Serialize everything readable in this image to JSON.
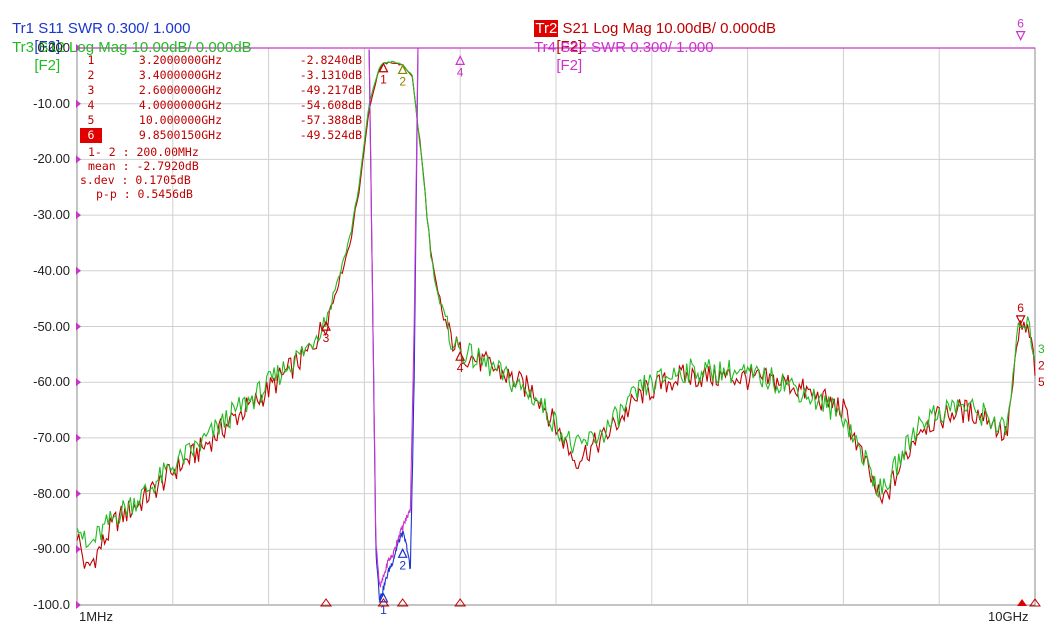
{
  "header": {
    "tr1": {
      "id": "Tr1",
      "text": "Tr1 S11 SWR 0.300/ 1.000",
      "fkey": "[F2]",
      "color": "#1a35d0"
    },
    "tr2": {
      "id": "Tr2",
      "text": " S21 Log Mag 10.00dB/ 0.000dB",
      "fkey": "[F2]",
      "color": "#c00000"
    },
    "tr3": {
      "id": "Tr3",
      "text": "Tr3 S12 Log Mag 10.00dB/ 0.000dB",
      "fkey": "[F2]",
      "color": "#22bb22"
    },
    "tr4": {
      "id": "Tr4",
      "text": "Tr4 S22 SWR 0.300/ 1.000",
      "fkey": "[F2]",
      "color": "#cc33cc"
    }
  },
  "markers": [
    {
      "num": "1",
      "freq": "3.2000000GHz",
      "value": "-2.8240dB",
      "active": false
    },
    {
      "num": "2",
      "freq": "3.4000000GHz",
      "value": "-3.1310dB",
      "active": false
    },
    {
      "num": "3",
      "freq": "2.6000000GHz",
      "value": "-49.217dB",
      "active": false
    },
    {
      "num": "4",
      "freq": "4.0000000GHz",
      "value": "-54.608dB",
      "active": false
    },
    {
      "num": "5",
      "freq": "10.000000GHz",
      "value": "-57.388dB",
      "active": false
    },
    {
      "num": "6",
      "freq": "9.8500150GHz",
      "value": "-49.524dB",
      "active": true
    }
  ],
  "stats": {
    "span": "1- 2 : 200.00MHz",
    "mean": "mean : -2.7920dB",
    "sdev": "s.dev : 0.1705dB",
    "pp": "p-p : 0.5456dB"
  },
  "chart_data": {
    "type": "line",
    "xlabel_start": "1MHz",
    "xlabel_end": "10GHz",
    "xlim_ghz": [
      0.001,
      10
    ],
    "ylim": [
      -100,
      0
    ],
    "yticks": [
      "0.000",
      "-10.00",
      "-20.00",
      "-30.00",
      "-40.00",
      "-50.00",
      "-60.00",
      "-70.00",
      "-80.00",
      "-90.00",
      "-100.0"
    ],
    "grid": true,
    "series": [
      {
        "name": "S21",
        "color": "#c00000",
        "x": [
          0.001,
          0.1,
          0.4,
          0.7,
          1.0,
          1.3,
          1.6,
          1.9,
          2.2,
          2.4,
          2.6,
          2.75,
          2.85,
          2.95,
          3.05,
          3.15,
          3.2,
          3.3,
          3.4,
          3.5,
          3.6,
          3.7,
          3.8,
          3.9,
          4.0,
          4.3,
          4.8,
          5.2,
          5.5,
          5.9,
          6.3,
          6.8,
          7.4,
          8.0,
          8.4,
          8.8,
          9.2,
          9.5,
          9.7,
          9.85,
          9.95,
          10.0
        ],
        "y": [
          -87,
          -94,
          -85,
          -81,
          -76,
          -72,
          -67,
          -63,
          -58,
          -55,
          -49.2,
          -41,
          -35,
          -25,
          -11,
          -4,
          -2.8,
          -2.6,
          -3.1,
          -5,
          -20,
          -38,
          -47,
          -52,
          -54.6,
          -57,
          -62,
          -74,
          -70,
          -62,
          -59,
          -59,
          -60,
          -65,
          -82,
          -68,
          -65,
          -66,
          -70,
          -49.5,
          -52,
          -57.4
        ]
      },
      {
        "name": "S12",
        "color": "#22bb22",
        "x": [
          0.001,
          0.1,
          0.4,
          0.7,
          1.0,
          1.3,
          1.6,
          1.9,
          2.2,
          2.4,
          2.6,
          2.75,
          2.85,
          2.95,
          3.05,
          3.15,
          3.2,
          3.3,
          3.4,
          3.5,
          3.6,
          3.7,
          3.8,
          3.9,
          4.0,
          4.3,
          4.8,
          5.2,
          5.5,
          5.9,
          6.3,
          6.8,
          7.4,
          8.0,
          8.4,
          8.8,
          9.2,
          9.5,
          9.7,
          9.85,
          9.95,
          10.0
        ],
        "y": [
          -84,
          -90,
          -84,
          -80,
          -75,
          -71,
          -66,
          -62,
          -57,
          -54,
          -48.5,
          -40,
          -34,
          -24,
          -10,
          -3.8,
          -2.6,
          -2.5,
          -3.0,
          -5,
          -20,
          -38,
          -47,
          -52,
          -54.4,
          -57,
          -63,
          -72,
          -69,
          -61,
          -58,
          -58,
          -60,
          -66,
          -80,
          -67,
          -64,
          -66,
          -69,
          -48,
          -51,
          -55
        ]
      },
      {
        "name": "S11",
        "color": "#1a35d0",
        "x": [
          3.05,
          3.09,
          3.12,
          3.16,
          3.2,
          3.25,
          3.3,
          3.35,
          3.4,
          3.45,
          3.48,
          3.52,
          3.56
        ],
        "y": [
          0,
          -50,
          -90,
          -99,
          -97,
          -94,
          -92,
          -89,
          -87,
          -90,
          -94,
          -60,
          0
        ]
      },
      {
        "name": "S22",
        "color": "#cc33cc",
        "x": [
          3.05,
          3.09,
          3.12,
          3.16,
          3.2,
          3.25,
          3.3,
          3.35,
          3.4,
          3.45,
          3.48,
          3.52,
          3.56
        ],
        "y": [
          0,
          -50,
          -88,
          -97,
          -95,
          -92,
          -91,
          -88,
          -86,
          -84,
          -83,
          -50,
          0
        ]
      }
    ],
    "point_markers": [
      {
        "label": "1",
        "x": 3.2,
        "y": -2.824,
        "color": "#c00000",
        "dir": "up"
      },
      {
        "label": "2",
        "x": 3.4,
        "y": -3.131,
        "color": "#888800",
        "dir": "up"
      },
      {
        "label": "3",
        "x": 2.6,
        "y": -49.217,
        "color": "#c00000",
        "dir": "up"
      },
      {
        "label": "4",
        "x": 4.0,
        "y": -54.608,
        "color": "#c00000",
        "dir": "up"
      },
      {
        "label": "6",
        "x": 9.85,
        "y": -49.524,
        "color": "#c00000",
        "dir": "down"
      },
      {
        "label": "1",
        "x": 3.2,
        "y": -98,
        "color": "#1a35d0",
        "dir": "up"
      },
      {
        "label": "2",
        "x": 3.4,
        "y": -90,
        "color": "#1a35d0",
        "dir": "up"
      },
      {
        "label": "4",
        "x": 4.0,
        "y": -1.5,
        "color": "#cc33cc",
        "dir": "up"
      },
      {
        "label": "6",
        "x": 9.85,
        "y": 1.5,
        "color": "#cc33cc",
        "dir": "down"
      }
    ],
    "edge_labels": [
      {
        "label": "3",
        "y": -54,
        "color": "#22bb22"
      },
      {
        "label": "2",
        "y": -57,
        "color": "#c00000"
      },
      {
        "label": "5",
        "y": -60,
        "color": "#c00000"
      }
    ]
  }
}
